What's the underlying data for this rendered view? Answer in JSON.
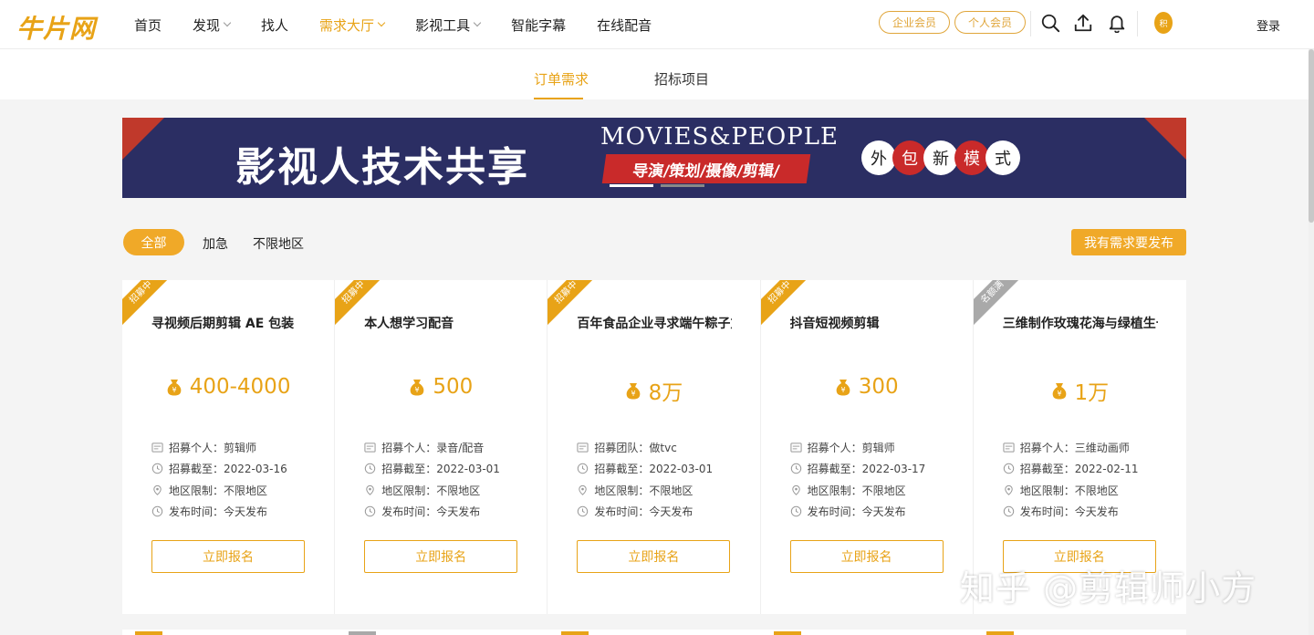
{
  "header": {
    "logo": "牛片网",
    "nav": [
      {
        "label": "首页",
        "dropdown": false,
        "active": false
      },
      {
        "label": "发现",
        "dropdown": true,
        "active": false
      },
      {
        "label": "找人",
        "dropdown": false,
        "active": false
      },
      {
        "label": "需求大厅",
        "dropdown": true,
        "active": true
      },
      {
        "label": "影视工具",
        "dropdown": true,
        "active": false
      },
      {
        "label": "智能字幕",
        "dropdown": false,
        "active": false
      },
      {
        "label": "在线配音",
        "dropdown": false,
        "active": false
      }
    ],
    "enterprise_member": "企业会员",
    "personal_member": "个人会员",
    "avatar_text": "积",
    "login": "登录"
  },
  "subtabs": [
    "订单需求",
    "招标项目"
  ],
  "banner": {
    "title": "影视人技术共享",
    "english": "MOVIES&PEOPLE",
    "ribbon": "导演/策划/摄像/剪辑/",
    "words": [
      "外",
      "包",
      "新",
      "模",
      "式"
    ]
  },
  "filters": {
    "all": "全部",
    "urgent": "加急",
    "unlimited_region": "不限地区",
    "publish": "我有需求要发布"
  },
  "cards": [
    {
      "tag": "招募中",
      "tag_state": "open",
      "title": "寻视频后期剪辑 AE 包装",
      "price": "400-4000",
      "recruit_label": "招募个人：",
      "recruit_value": "剪辑师",
      "deadline_label": "招募截至：",
      "deadline_value": "2022-03-16",
      "region_label": "地区限制：",
      "region_value": "不限地区",
      "publish_label": "发布时间：",
      "publish_value": "今天发布",
      "apply": "立即报名"
    },
    {
      "tag": "招募中",
      "tag_state": "open",
      "title": "本人想学习配音",
      "price": "500",
      "recruit_label": "招募个人：",
      "recruit_value": "录音/配音",
      "deadline_label": "招募截至：",
      "deadline_value": "2022-03-01",
      "region_label": "地区限制：",
      "region_value": "不限地区",
      "publish_label": "发布时间：",
      "publish_value": "今天发布",
      "apply": "立即报名"
    },
    {
      "tag": "招募中",
      "tag_state": "open",
      "title": "百年食品企业寻求端午粽子方",
      "price": "8万",
      "recruit_label": "招募团队：",
      "recruit_value": "做tvc",
      "deadline_label": "招募截至：",
      "deadline_value": "2022-03-01",
      "region_label": "地区限制：",
      "region_value": "不限地区",
      "publish_label": "发布时间：",
      "publish_value": "今天发布",
      "apply": "立即报名"
    },
    {
      "tag": "招募中",
      "tag_state": "open",
      "title": "抖音短视频剪辑",
      "price": "300",
      "recruit_label": "招募个人：",
      "recruit_value": "剪辑师",
      "deadline_label": "招募截至：",
      "deadline_value": "2022-03-17",
      "region_label": "地区限制：",
      "region_value": "不限地区",
      "publish_label": "发布时间：",
      "publish_value": "今天发布",
      "apply": "立即报名"
    },
    {
      "tag": "名额满",
      "tag_state": "full",
      "title": "三维制作玫瑰花海与绿植生长",
      "price": "1万",
      "recruit_label": "招募个人：",
      "recruit_value": "三维动画师",
      "deadline_label": "招募截至：",
      "deadline_value": "2022-02-11",
      "region_label": "地区限制：",
      "region_value": "不限地区",
      "publish_label": "发布时间：",
      "publish_value": "今天发布",
      "apply": "立即报名"
    }
  ],
  "watermark": "知乎 @剪辑师小方",
  "colors": {
    "accent": "#e8a317",
    "banner_bg": "#2b2e63",
    "banner_red": "#c92a2a",
    "tag_full": "#a9a9a9"
  }
}
